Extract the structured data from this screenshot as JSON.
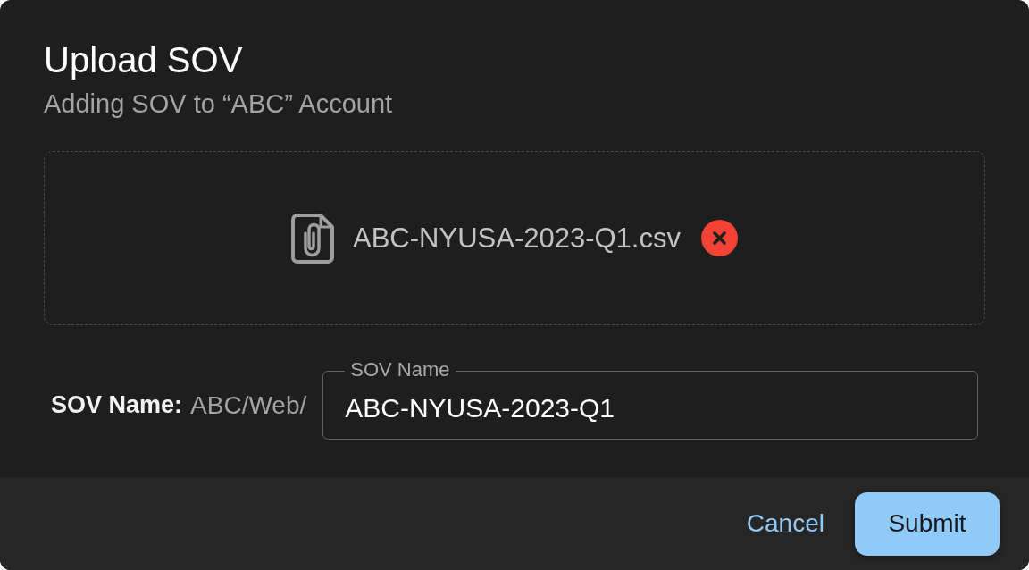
{
  "dialog": {
    "title": "Upload SOV",
    "subtitle": "Adding SOV to “ABC” Account",
    "dropzone": {
      "file_name": "ABC-NYUSA-2023-Q1.csv"
    },
    "sov_name": {
      "label": "SOV Name:",
      "prefix": "ABC/Web/",
      "field": {
        "label": "SOV Name",
        "value": "ABC-NYUSA-2023-Q1"
      }
    },
    "buttons": [
      {
        "label": "Cancel",
        "kind": "text"
      },
      {
        "label": "Submit",
        "kind": "contained"
      }
    ]
  }
}
